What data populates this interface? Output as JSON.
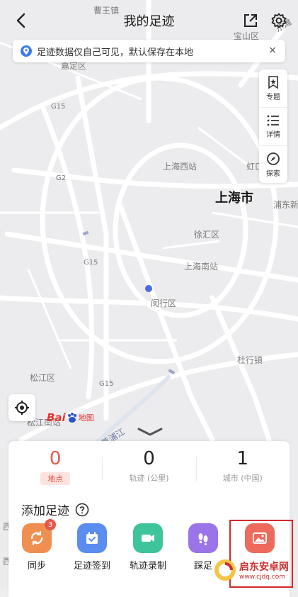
{
  "header": {
    "title": "我的足迹"
  },
  "notice": {
    "text": "足迹数据仅自己可见，默认保存在本地",
    "close": "×"
  },
  "side_panel": {
    "items": [
      {
        "label": "专题"
      },
      {
        "label": "详情"
      },
      {
        "label": "探索"
      }
    ]
  },
  "map": {
    "labels": {
      "caowangzhen": "曹王镇",
      "baoshan": "宝山区",
      "jiading": "嘉定区",
      "g15_top": "G15",
      "shanghai_west": "上海西站",
      "hongkou": "虹口",
      "shanghai": "上海市",
      "pudong": "浦东新",
      "g2": "G2",
      "xuhui": "徐汇区",
      "g15_mid": "G15",
      "shanghai_south": "上海南站",
      "minhang": "闵行区",
      "dongtan": "东滩",
      "songjiang": "松江区",
      "g15_bottom": "G15",
      "minhang_bottom": "杜行镇",
      "huangpujiang": "黄浦江",
      "songjiang_south": "松江南站",
      "xi": "西",
      "xi2": "西"
    }
  },
  "logo": {
    "bai": "Bai",
    "ditu": "地图"
  },
  "stats": [
    {
      "value": "0",
      "label": "地点",
      "active": true
    },
    {
      "value": "0",
      "label": "轨迹 (公里)"
    },
    {
      "value": "1",
      "label": "城市 (中国)"
    }
  ],
  "add_section": {
    "title": "添加足迹"
  },
  "actions": [
    {
      "label": "同步",
      "badge": "3",
      "color": "#f09050"
    },
    {
      "label": "足迹签到",
      "color": "#5b8def"
    },
    {
      "label": "轨迹录制",
      "color": "#3ec49a"
    },
    {
      "label": "踩足",
      "color": "#9a74e8"
    },
    {
      "label": "",
      "color": "#ee6a5c"
    }
  ],
  "watermark": {
    "name": "启东安卓网",
    "url": "www.cjdq.com"
  },
  "colors": {
    "accent": "#e8574b",
    "map_bg": "#eeeeef",
    "road": "#ffffff"
  }
}
